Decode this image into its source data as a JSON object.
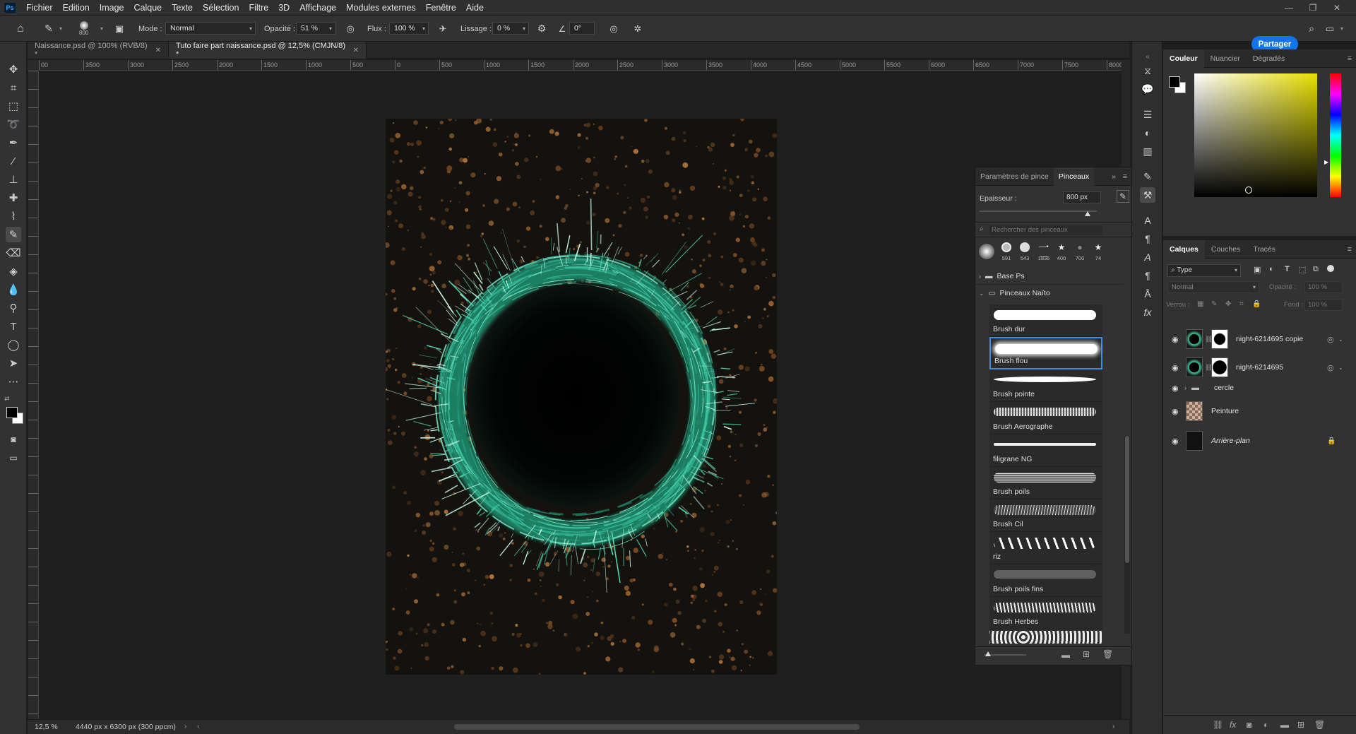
{
  "app": {
    "logo": "Ps"
  },
  "menu": [
    "Fichier",
    "Edition",
    "Image",
    "Calque",
    "Texte",
    "Sélection",
    "Filtre",
    "3D",
    "Affichage",
    "Modules externes",
    "Fenêtre",
    "Aide"
  ],
  "options": {
    "brush_size": "800",
    "mode_label": "Mode :",
    "mode_value": "Normal",
    "opacity_label": "Opacité :",
    "opacity_value": "51 %",
    "flux_label": "Flux :",
    "flux_value": "100 %",
    "lissage_label": "Lissage :",
    "lissage_value": "0 %",
    "angle_value": "0°",
    "share_label": "Partager"
  },
  "tabs": [
    {
      "label": "Naissance.psd @ 100% (RVB/8) *"
    },
    {
      "label": "Tuto faire part naissance.psd @ 12,5% (CMJN/8) *"
    }
  ],
  "ruler": [
    "00",
    "3500",
    "3000",
    "2500",
    "2000",
    "1500",
    "1000",
    "500",
    "0",
    "500",
    "1000",
    "1500",
    "2000",
    "2500",
    "3000",
    "3500",
    "4000",
    "4500",
    "5000",
    "5500",
    "6000",
    "6500",
    "7000",
    "7500",
    "8000"
  ],
  "status": {
    "zoom": "12,5 %",
    "doc_info": "4440 px x 6300 px (300 ppcm)"
  },
  "brush_panel": {
    "tab1": "Paramètres de pince",
    "tab2": "Pinceaux",
    "size_label": "Epaisseur :",
    "size_value": "800 px",
    "search_placeholder": "Rechercher des pinceaux",
    "recent_sizes": [
      "591",
      "543",
      "1836",
      "400",
      "700",
      "74"
    ],
    "groups": [
      "Base Ps",
      "Pinceaux Naïto"
    ],
    "brushes": [
      "Brush dur",
      "Brush flou",
      "Brush pointe",
      "Brush Aerographe",
      "filigrane NG",
      "Brush poils",
      "Brush Cil",
      "riz",
      "Brush poils fins",
      "Brush Herbes"
    ]
  },
  "color_panel": {
    "tabs": [
      "Couleur",
      "Nuancier",
      "Dégradés"
    ]
  },
  "layers_panel": {
    "tabs": [
      "Calques",
      "Couches",
      "Tracés"
    ],
    "filter": "Type",
    "blend": "Normal",
    "opacity_label": "Opacité :",
    "opacity_value": "100 %",
    "lock_label": "Verrou :",
    "fill_label": "Fond :",
    "fill_value": "100 %",
    "layers": [
      {
        "name": "night-6214695 copie"
      },
      {
        "name": "night-6214695"
      },
      {
        "name": "cercle"
      },
      {
        "name": "Peinture"
      },
      {
        "name": "Arrière-plan"
      }
    ]
  },
  "colors": {
    "accent": "#1473e6",
    "panel": "#323232",
    "teal": "#3fc9a0",
    "orange": "#a0642e"
  }
}
